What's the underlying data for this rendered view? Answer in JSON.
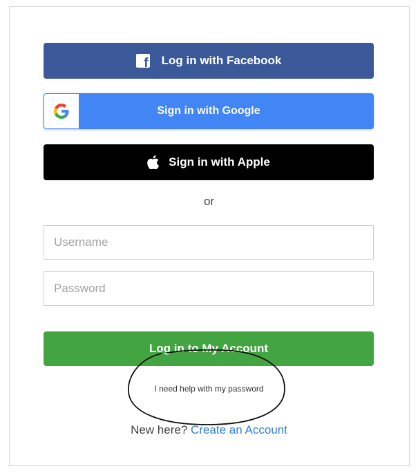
{
  "login": {
    "facebook_label": "Log in with Facebook",
    "google_label": "Sign in with Google",
    "apple_label": "Sign in with Apple",
    "or_text": "or",
    "username_placeholder": "Username",
    "password_placeholder": "Password",
    "login_button_label": "Log in to My Account",
    "help_link": "I need help with my password",
    "new_here_text": "New here?",
    "create_account_link": "Create an Account"
  },
  "icons": {
    "facebook": "facebook-icon",
    "google": "google-icon",
    "apple": "apple-icon"
  },
  "colors": {
    "facebook": "#3b5998",
    "google": "#4285f4",
    "apple": "#000000",
    "login": "#43a542",
    "link": "#2e7fd8"
  }
}
